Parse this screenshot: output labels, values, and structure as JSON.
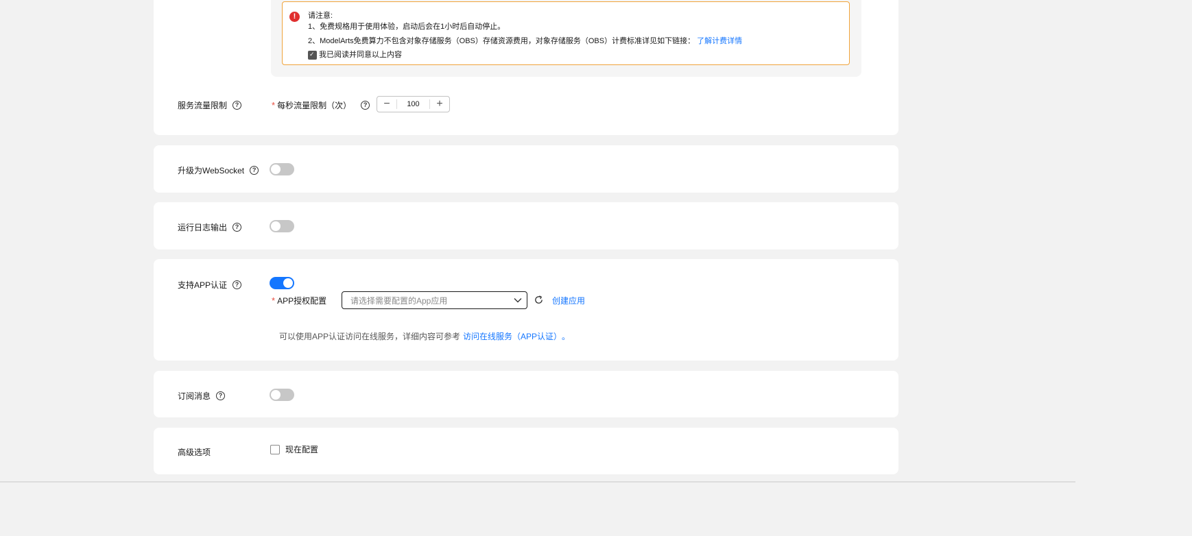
{
  "notice": {
    "title": "请注意:",
    "line1": "1、免费规格用于使用体验，启动后会在1小时后自动停止。",
    "line2": "2、ModelArts免费算力不包含对象存储服务（OBS）存储资源费用，对象存储服务（OBS）计费标准详见如下链接：",
    "line2_link": "了解计费详情",
    "agree_label": "我已阅读并同意以上内容",
    "agree_checked": true
  },
  "traffic": {
    "section_label": "服务流量限制",
    "field_label": "每秒流量限制（次）",
    "value": "100",
    "minus": "−",
    "plus": "+"
  },
  "websocket": {
    "label": "升级为WebSocket",
    "enabled": false
  },
  "runlog": {
    "label": "运行日志输出",
    "enabled": false
  },
  "app_auth": {
    "label": "支持APP认证",
    "enabled": true,
    "config_label": "APP授权配置",
    "select_placeholder": "请选择需要配置的App应用",
    "create_link": "创建应用",
    "hint": "可以使用APP认证访问在线服务，详细内容可参考",
    "hint_link": "访问在线服务（APP认证）",
    "hint_end": "。"
  },
  "subscribe": {
    "label": "订阅消息",
    "enabled": false
  },
  "advanced": {
    "label": "高级选项",
    "checkbox_label": "现在配置",
    "checked": false
  },
  "icons": {
    "help": "question-circle-icon",
    "warning": "exclamation-circle-icon",
    "refresh": "refresh-icon",
    "chevron": "chevron-down-icon"
  },
  "colors": {
    "accent": "#1476ff",
    "warning_border": "#f0a33a",
    "required": "#e84e40",
    "warning_icon": "#e02f2f"
  }
}
